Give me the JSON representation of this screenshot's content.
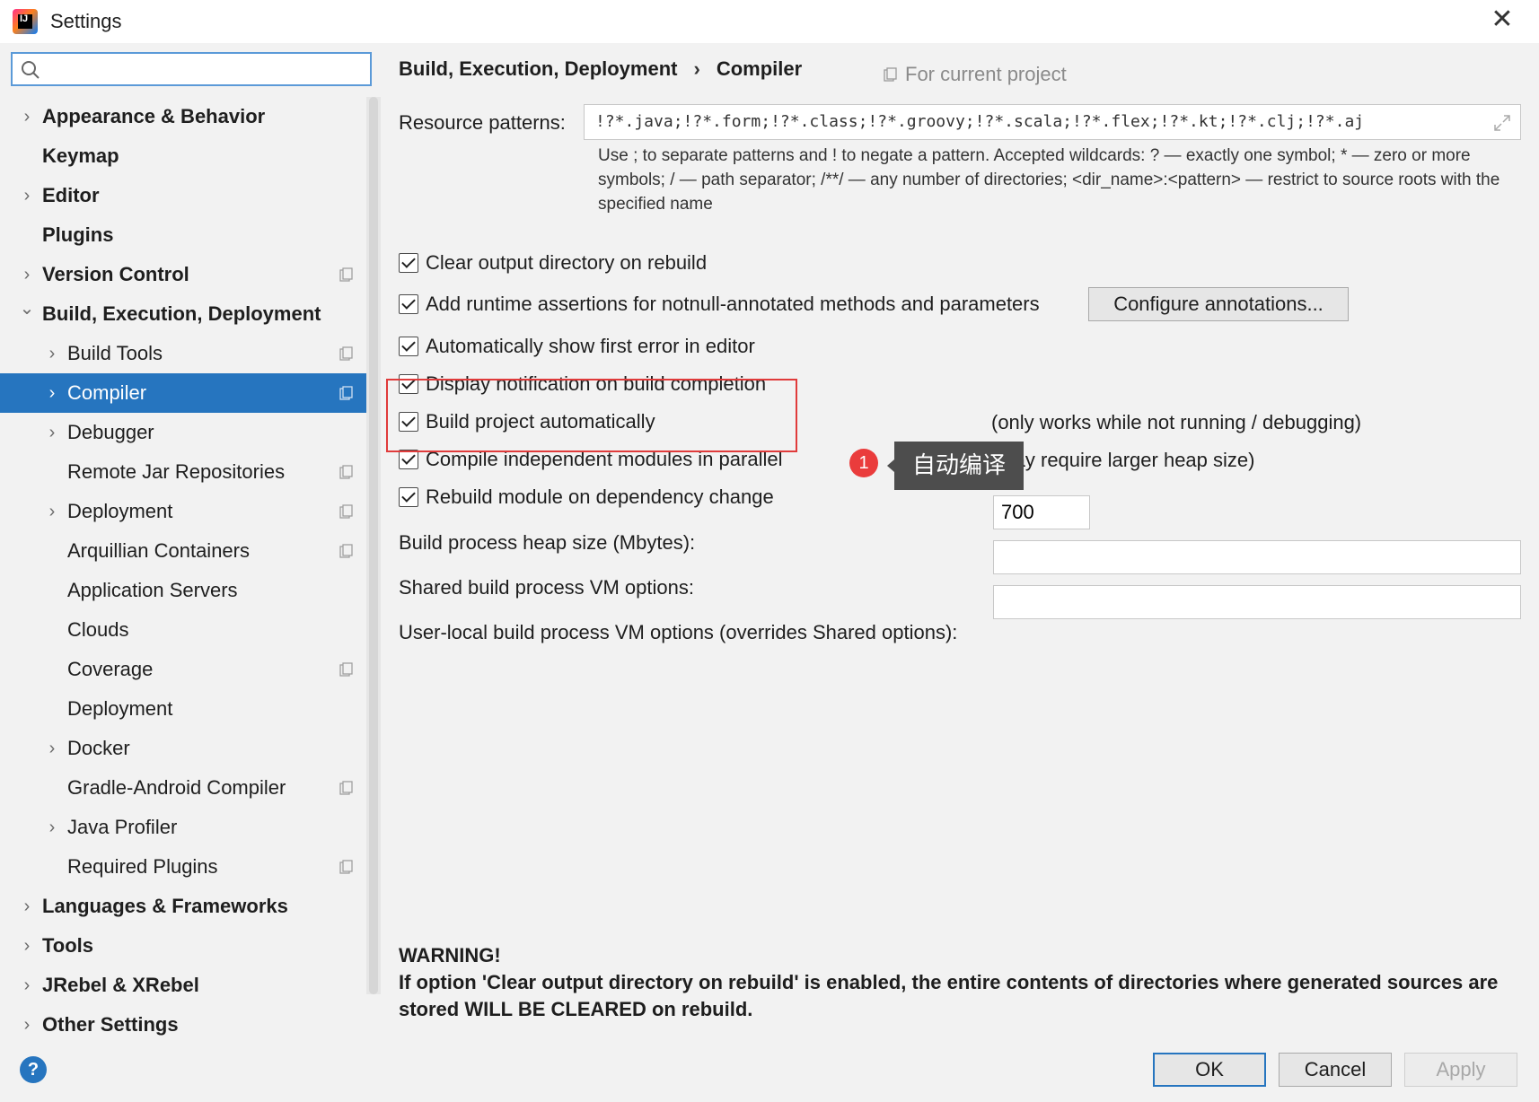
{
  "window": {
    "title": "Settings"
  },
  "search": {
    "value": "",
    "placeholder": ""
  },
  "tree": [
    {
      "label": "Appearance & Behavior",
      "level": 0,
      "arrow": "right",
      "proj": false
    },
    {
      "label": "Keymap",
      "level": 0,
      "arrow": "",
      "proj": false
    },
    {
      "label": "Editor",
      "level": 0,
      "arrow": "right",
      "proj": false
    },
    {
      "label": "Plugins",
      "level": 0,
      "arrow": "",
      "proj": false
    },
    {
      "label": "Version Control",
      "level": 0,
      "arrow": "right",
      "proj": true
    },
    {
      "label": "Build, Execution, Deployment",
      "level": 0,
      "arrow": "down",
      "proj": false
    },
    {
      "label": "Build Tools",
      "level": 1,
      "arrow": "right",
      "proj": true
    },
    {
      "label": "Compiler",
      "level": 1,
      "arrow": "right",
      "proj": true,
      "selected": true
    },
    {
      "label": "Debugger",
      "level": 1,
      "arrow": "right",
      "proj": false
    },
    {
      "label": "Remote Jar Repositories",
      "level": 1,
      "arrow": "",
      "proj": true
    },
    {
      "label": "Deployment",
      "level": 1,
      "arrow": "right",
      "proj": true
    },
    {
      "label": "Arquillian Containers",
      "level": 1,
      "arrow": "",
      "proj": true
    },
    {
      "label": "Application Servers",
      "level": 1,
      "arrow": "",
      "proj": false
    },
    {
      "label": "Clouds",
      "level": 1,
      "arrow": "",
      "proj": false
    },
    {
      "label": "Coverage",
      "level": 1,
      "arrow": "",
      "proj": true
    },
    {
      "label": "Deployment",
      "level": 1,
      "arrow": "",
      "proj": false
    },
    {
      "label": "Docker",
      "level": 1,
      "arrow": "right",
      "proj": false
    },
    {
      "label": "Gradle-Android Compiler",
      "level": 1,
      "arrow": "",
      "proj": true
    },
    {
      "label": "Java Profiler",
      "level": 1,
      "arrow": "right",
      "proj": false
    },
    {
      "label": "Required Plugins",
      "level": 1,
      "arrow": "",
      "proj": true
    },
    {
      "label": "Languages & Frameworks",
      "level": 0,
      "arrow": "right",
      "proj": false
    },
    {
      "label": "Tools",
      "level": 0,
      "arrow": "right",
      "proj": false
    },
    {
      "label": "JRebel & XRebel",
      "level": 0,
      "arrow": "right",
      "proj": false
    },
    {
      "label": "Other Settings",
      "level": 0,
      "arrow": "right",
      "proj": false
    }
  ],
  "breadcrumb": {
    "parent": "Build, Execution, Deployment",
    "separator": "›",
    "current": "Compiler"
  },
  "for_project": "For current project",
  "resource": {
    "label": "Resource patterns:",
    "value": "!?*.java;!?*.form;!?*.class;!?*.groovy;!?*.scala;!?*.flex;!?*.kt;!?*.clj;!?*.aj",
    "help": "Use ; to separate patterns and ! to negate a pattern. Accepted wildcards: ? — exactly one symbol; * — zero or more symbols; / — path separator; /**/ — any number of directories; <dir_name>:<pattern> — restrict to source roots with the specified name"
  },
  "options": {
    "clear_output": "Clear output directory on rebuild",
    "runtime_assertions": "Add runtime assertions for notnull-annotated methods and parameters",
    "configure_annotations": "Configure annotations...",
    "show_first_error": "Automatically show first error in editor",
    "display_notification": "Display notification on build completion",
    "build_automatically": "Build project automatically",
    "build_automatically_note": "(only works while not running / debugging)",
    "compile_parallel": "Compile independent modules in parallel",
    "compile_parallel_note": "(may require larger heap size)",
    "rebuild_on_dependency": "Rebuild module on dependency change"
  },
  "annotation": {
    "badge": "1",
    "tip": "自动编译",
    "color": "#e03b3b"
  },
  "fields": {
    "heap_label": "Build process heap size (Mbytes):",
    "heap_value": "700",
    "shared_vm_label": "Shared build process VM options:",
    "shared_vm_value": "",
    "local_vm_label": "User-local build process VM options (overrides Shared options):",
    "local_vm_value": ""
  },
  "warning": {
    "title": "WARNING!",
    "text": "If option 'Clear output directory on rebuild' is enabled, the entire contents of directories where generated sources are stored WILL BE CLEARED on rebuild."
  },
  "buttons": {
    "ok": "OK",
    "cancel": "Cancel",
    "apply": "Apply",
    "help": "?"
  },
  "colors": {
    "accent": "#2675bf",
    "highlight": "#e03b3b"
  }
}
